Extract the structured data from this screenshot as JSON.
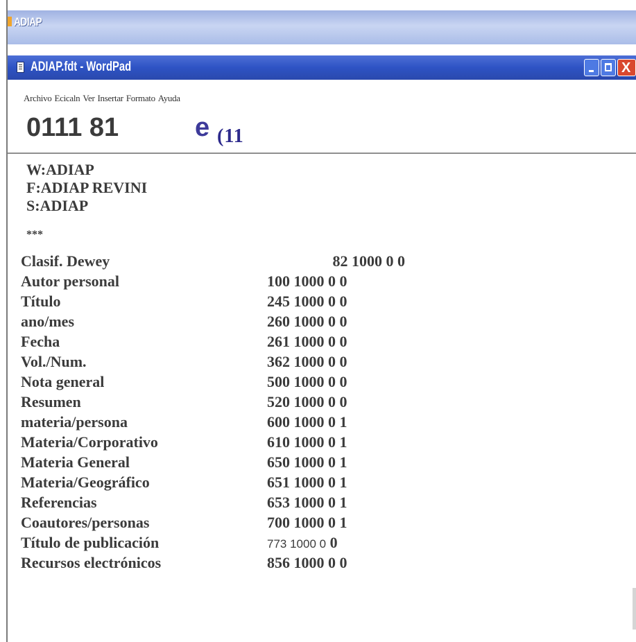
{
  "outer_window": {
    "title": "ADIAP"
  },
  "window": {
    "title": "ADIAP.fdt - WordPad",
    "controls": {
      "minimize": "minimize",
      "maximize": "maximize",
      "close": "X"
    }
  },
  "menu": [
    "Archivo",
    "Ecicaln",
    "Ver",
    "Insertar",
    "Formato",
    "Ayuda"
  ],
  "toolbar": {
    "font_text": "0111 81",
    "e_text": "e",
    "paren_text": "(11"
  },
  "document": {
    "header_lines": [
      "W:ADIAP",
      "F:ADIAP REVINI",
      "S:ADIAP"
    ],
    "stars": "***",
    "rows": [
      {
        "label": "Clasif. Dewey",
        "value": "82 1000 0 0"
      },
      {
        "label": "Autor personal",
        "value": "100 1000 0 0"
      },
      {
        "label": "Título",
        "value": "245 1000 0 0"
      },
      {
        "label": "ano/mes",
        "value": "260 1000 0 0"
      },
      {
        "label": "Fecha",
        "value": "261 1000 0 0"
      },
      {
        "label": "Vol./Num.",
        "value": "362 1000 0 0"
      },
      {
        "label": "Nota general",
        "value": "500 1000 0 0"
      },
      {
        "label": "Resumen",
        "value": "520 1000 0 0"
      },
      {
        "label": "materia/persona",
        "value": "600 1000 0 1"
      },
      {
        "label": "Materia/Corporativo",
        "value": "610 1000 0 1"
      },
      {
        "label": "Materia General",
        "value": "650 1000 0 1"
      },
      {
        "label": "Materia/Geográfico",
        "value": "651 1000 0 1"
      },
      {
        "label": "Referencias",
        "value": "653 1000 0 1"
      },
      {
        "label": "Coautores/personas",
        "value": "700 1000 0 1"
      },
      {
        "label": "Título de publicación",
        "value_plain": "773 1000 0",
        "value_bold": "0"
      },
      {
        "label": "Recursos electrónicos",
        "value": "856 1000 0 0"
      }
    ]
  }
}
